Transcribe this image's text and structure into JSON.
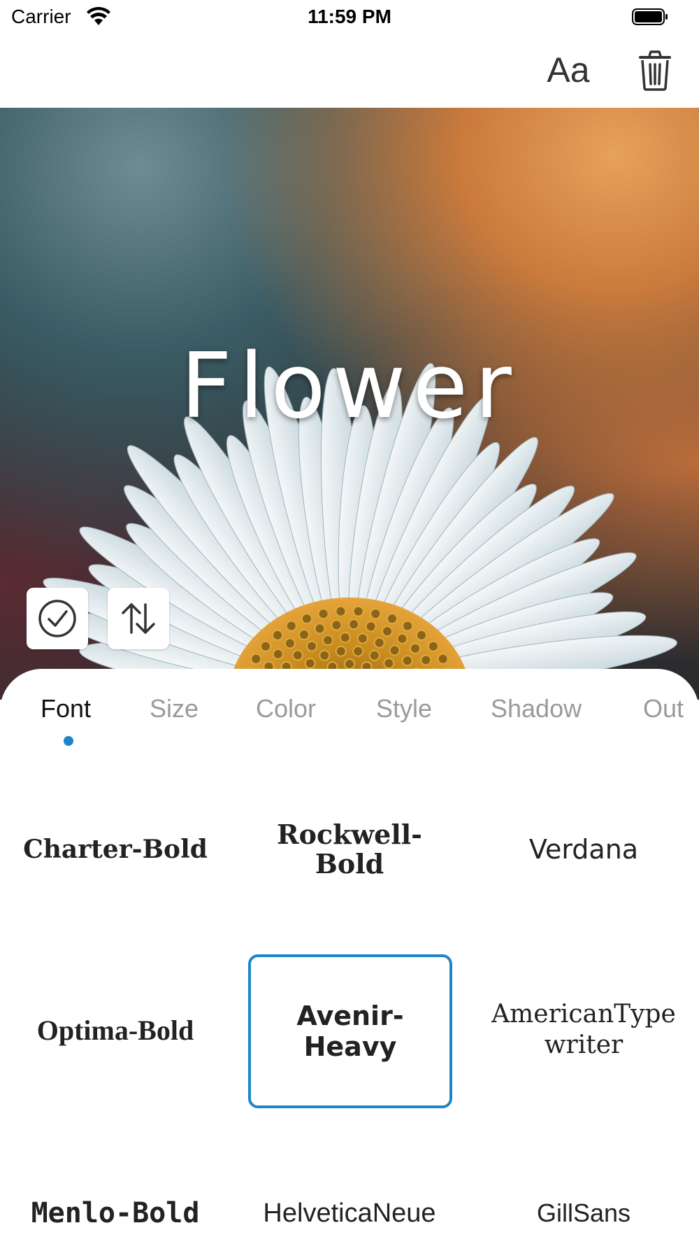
{
  "status_bar": {
    "carrier": "Carrier",
    "time": "11:59 PM"
  },
  "toolbar": {
    "text_button_label": "Aa",
    "text_button_icon": "text-format-icon",
    "delete_icon": "trash-icon"
  },
  "photo": {
    "caption": "Flower",
    "confirm_icon": "checkmark-circle-icon",
    "swap_icon": "swap-vertical-arrows-icon"
  },
  "tabs": [
    {
      "label": "Font",
      "active": true
    },
    {
      "label": "Size",
      "active": false
    },
    {
      "label": "Color",
      "active": false
    },
    {
      "label": "Style",
      "active": false
    },
    {
      "label": "Shadow",
      "active": false
    },
    {
      "label": "Out",
      "active": false
    }
  ],
  "fonts": [
    {
      "label": "Charter-Bold",
      "selected": false
    },
    {
      "label": "Rockwell-Bold",
      "selected": false
    },
    {
      "label": "Verdana",
      "selected": false
    },
    {
      "label": "Optima-Bold",
      "selected": false
    },
    {
      "label": "Avenir-Heavy",
      "selected": true
    },
    {
      "label": "AmericanTypewriter",
      "selected": false
    },
    {
      "label": "Menlo-Bold",
      "selected": false
    },
    {
      "label": "HelveticaNeue",
      "selected": false
    },
    {
      "label": "GillSans",
      "selected": false
    }
  ],
  "colors": {
    "accent": "#1f85c6",
    "active_tab_text": "#111111",
    "inactive_tab_text": "#9a9a9a"
  }
}
